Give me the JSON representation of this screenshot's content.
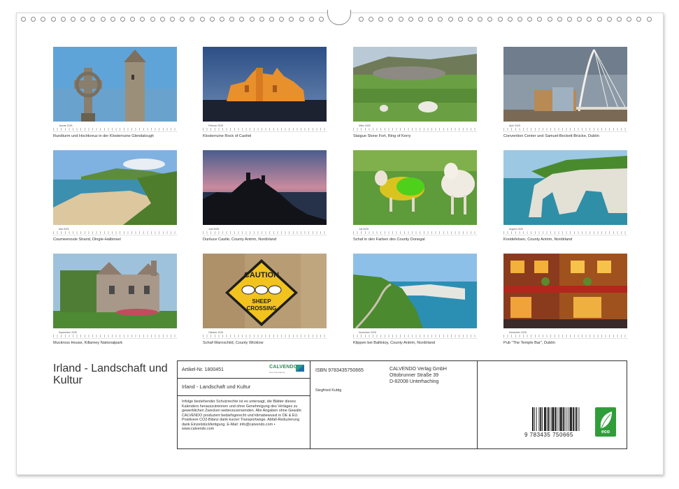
{
  "months": [
    {
      "month_label": "Januar 2025",
      "caption": "Rundturm und Hochkreuz in der Klosterruine Glendalough",
      "scene": "round-tower-celtic-cross"
    },
    {
      "month_label": "Februar 2025",
      "caption": "Klosterruine Rock of Cashel",
      "scene": "rock-of-cashel-night"
    },
    {
      "month_label": "März 2025",
      "caption": "Staigue Stone Fort, Ring of Kerry",
      "scene": "stone-fort-sheep"
    },
    {
      "month_label": "April 2025",
      "caption": "Convention Center und Samuel-Beckett-Brücke, Dublin",
      "scene": "harp-bridge-dublin"
    },
    {
      "month_label": "Mai 2025",
      "caption": "Coumeenoule Strand, Dingle-Halbinsel",
      "scene": "beach-cliffs"
    },
    {
      "month_label": "Juni 2025",
      "caption": "Dunluce Castle, County Antrim, Nordirland",
      "scene": "castle-silhouette-dusk"
    },
    {
      "month_label": "Juli 2025",
      "caption": "Schaf in den Farben des County Donegal",
      "scene": "painted-sheep"
    },
    {
      "month_label": "August 2025",
      "caption": "Kreidefelsen, County Antrim, Nordirland",
      "scene": "white-rock-arch"
    },
    {
      "month_label": "September 2025",
      "caption": "Muckross House, Killarney Nationalpark",
      "scene": "manor-house"
    },
    {
      "month_label": "Oktober 2025",
      "caption": "Schaf-Warnschild, County Wicklow",
      "scene": "sheep-crossing-sign"
    },
    {
      "month_label": "November 2025",
      "caption": "Klippen bei Ballintoy, County Antrim, Nordirland",
      "scene": "coastal-cliff-path"
    },
    {
      "month_label": "Dezember 2025",
      "caption": "Pub \"The Temple Bar\", Dublin",
      "scene": "temple-bar-pub"
    }
  ],
  "sign": {
    "line1": "CAUTION",
    "line2": "SHEEP",
    "line3": "CROSSING"
  },
  "cover": {
    "title": "Irland - Landschaft und Kultur"
  },
  "info": {
    "article": "Artikel-Nr. 1800451",
    "logo": "CALVENDO",
    "logo_sub": "Das Kalendarium",
    "product_title": "Irland - Landschaft und Kultur",
    "legal_text": "Infolge bestehender Schutzrechte ist es untersagt, die Blätter dieses Kalenders herauszutrennen und ohne Genehmigung des Verlages zu gewerblichen Zwecken weiterzuverwenden. Alle Angaben ohne Gewähr. CALVENDO produziert bedarfsgerecht und klimabewusst in DE & EU. Positivere CO2-Bilanz dank kurzer Transportwege. Abfall-Reduzierung dank Einzelstückfertigung. E-Mail: info@calvendo.com • www.calvendo.com",
    "isbn": "ISBN 9783435750665",
    "author": "Siegfried Kuttig",
    "publisher_name": "CALVENDO Verlag GmbH",
    "publisher_street": "Ottobrunner Straße 39",
    "publisher_city": "D-82008 Unterhaching",
    "barcode_number": "9 783435 750665",
    "eco_label": "eco"
  },
  "colors": {
    "accent_green": "#2f9e3a",
    "frame": "#333333"
  }
}
